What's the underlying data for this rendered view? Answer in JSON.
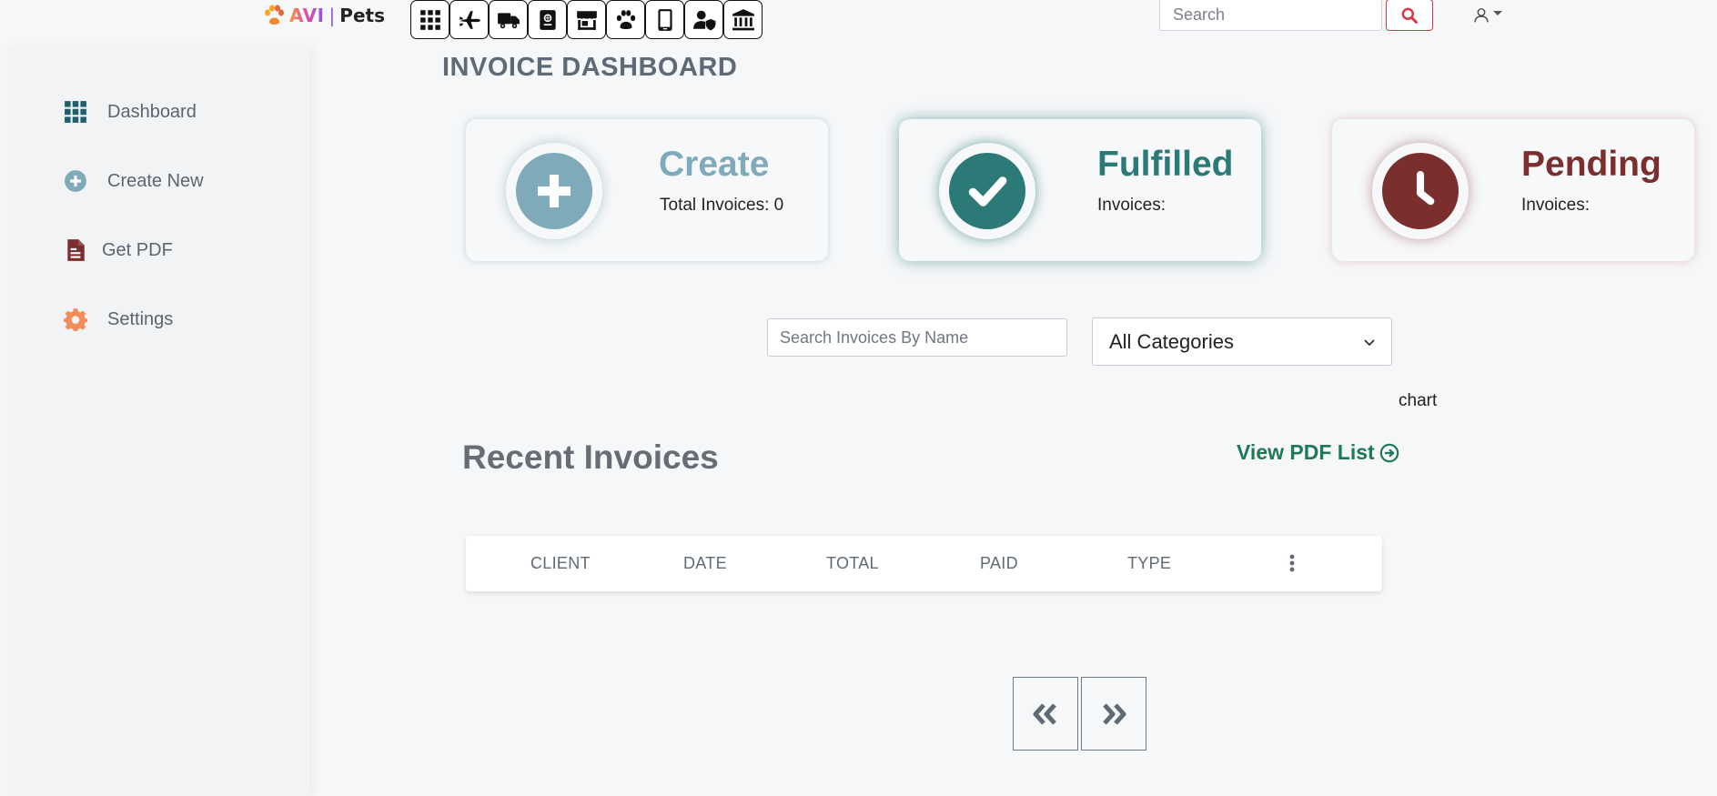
{
  "brand": {
    "avi": "AVI",
    "separator": "|",
    "pets": "Pets"
  },
  "app_icons": [
    {
      "name": "apps-grid-icon"
    },
    {
      "name": "airplane-icon"
    },
    {
      "name": "truck-icon"
    },
    {
      "name": "passport-icon"
    },
    {
      "name": "store-icon"
    },
    {
      "name": "paw-icon"
    },
    {
      "name": "mobile-phone-icon"
    },
    {
      "name": "user-shield-icon"
    },
    {
      "name": "bank-icon"
    }
  ],
  "header": {
    "search_placeholder": "Search",
    "search_icon": "search-icon",
    "user_icon": "user-icon"
  },
  "sidebar": {
    "items": [
      {
        "label": "Dashboard",
        "icon": "grid-icon",
        "color": "#1f5f6e"
      },
      {
        "label": "Create New",
        "icon": "plus-circle-icon",
        "color": "#7eaab9"
      },
      {
        "label": "Get PDF",
        "icon": "file-pdf-icon",
        "color": "#7a2e2e"
      },
      {
        "label": "Settings",
        "icon": "gear-icon",
        "color": "#f28c5a"
      }
    ]
  },
  "page": {
    "title": "INVOICE DASHBOARD"
  },
  "cards": {
    "create": {
      "title": "Create",
      "subtitle": "Total Invoices: 0",
      "color": "#7eaab9"
    },
    "fulfilled": {
      "title": "Fulfilled",
      "subtitle": "Invoices:",
      "color": "#2c7a78"
    },
    "pending": {
      "title": "Pending",
      "subtitle": "Invoices:",
      "color": "#7a2e2e"
    }
  },
  "filters": {
    "search_placeholder": "Search Invoices By Name",
    "category_selected": "All Categories"
  },
  "chart_placeholder": "chart",
  "recent": {
    "title": "Recent Invoices",
    "pdf_link": "View PDF List",
    "link_color": "#1d7a55",
    "columns": [
      "CLIENT",
      "DATE",
      "TOTAL",
      "PAID",
      "TYPE"
    ]
  },
  "pagination": {
    "prev_icon": "double-chevron-left-icon",
    "next_icon": "double-chevron-right-icon"
  }
}
